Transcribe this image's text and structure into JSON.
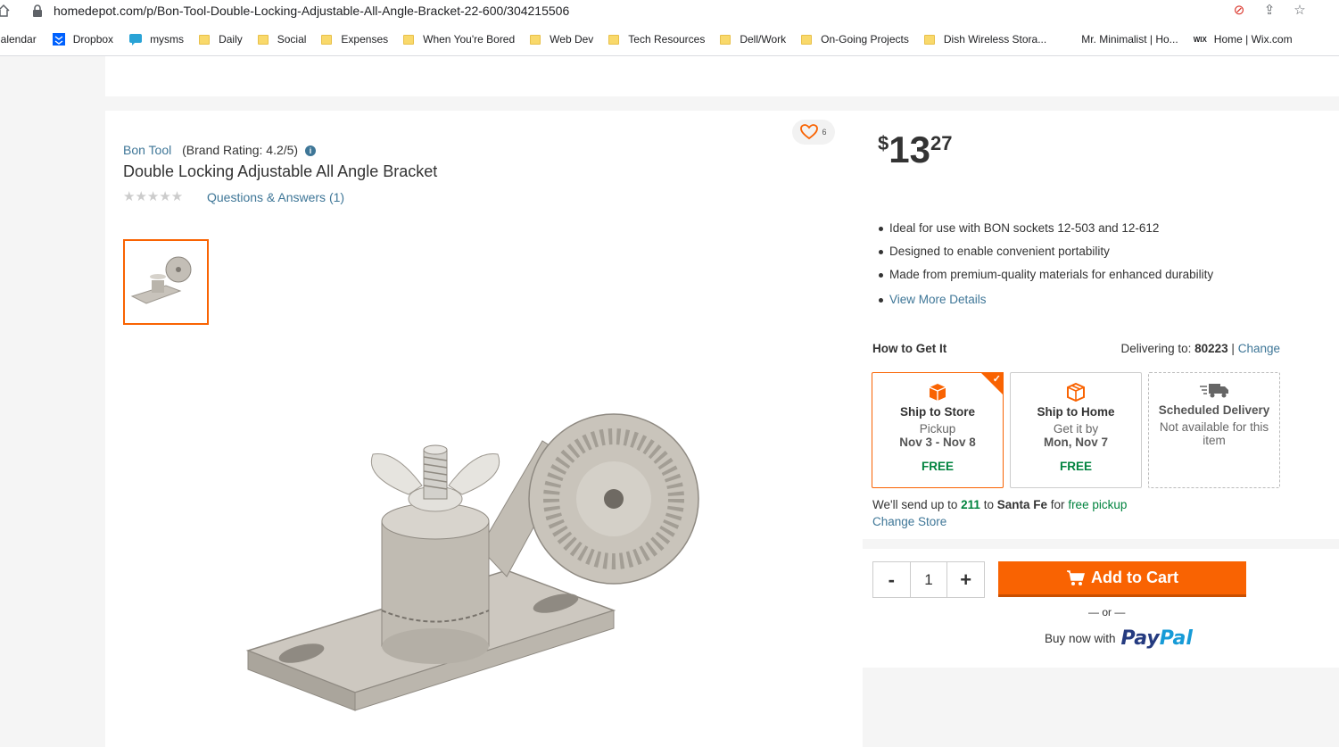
{
  "browser": {
    "url": "homedepot.com/p/Bon-Tool-Double-Locking-Adjustable-All-Angle-Bracket-22-600/304215506"
  },
  "bookmarks": [
    {
      "label": "Calendar",
      "icon": "calendar-icon"
    },
    {
      "label": "Dropbox",
      "icon": "dropbox-icon"
    },
    {
      "label": "mysms",
      "icon": "mysms-icon"
    },
    {
      "label": "Daily",
      "icon": "folder-icon"
    },
    {
      "label": "Social",
      "icon": "folder-icon"
    },
    {
      "label": "Expenses",
      "icon": "folder-icon"
    },
    {
      "label": "When You're Bored",
      "icon": "folder-icon"
    },
    {
      "label": "Web Dev",
      "icon": "folder-icon"
    },
    {
      "label": "Tech Resources",
      "icon": "folder-icon"
    },
    {
      "label": "Dell/Work",
      "icon": "folder-icon"
    },
    {
      "label": "On-Going Projects",
      "icon": "folder-icon"
    },
    {
      "label": "Dish Wireless Stora...",
      "icon": "folder-icon"
    },
    {
      "label": "Mr. Minimalist | Ho...",
      "icon": "page-icon"
    },
    {
      "label": "Home | Wix.com",
      "icon": "wix-icon"
    }
  ],
  "product": {
    "brand": "Bon Tool",
    "brand_rating": "(Brand Rating: 4.2/5)",
    "title": "Double Locking Adjustable All Angle Bracket",
    "stars": "★★★★★",
    "qa_link": "Questions & Answers (1)",
    "favorite_count": "6"
  },
  "price": {
    "currency": "$",
    "dollars": "13",
    "cents": "27"
  },
  "highlights": [
    "Ideal for use with BON sockets 12-503 and 12-612",
    "Designed to enable convenient portability",
    "Made from premium-quality materials for enhanced durability"
  ],
  "view_more": "View More Details",
  "fulfillment": {
    "heading": "How to Get It",
    "delivering_label": "Delivering to:",
    "zip": "80223",
    "separator": "|",
    "change": "Change",
    "options": [
      {
        "title": "Ship to Store",
        "line1": "Pickup",
        "line2": "Nov 3 - Nov 8",
        "price": "FREE"
      },
      {
        "title": "Ship to Home",
        "line1": "Get it by",
        "line2": "Mon, Nov 7",
        "price": "FREE"
      },
      {
        "title": "Scheduled Delivery",
        "line1": "Not available for this item"
      }
    ],
    "send_pre": "We'll send up to",
    "send_count": "211",
    "send_mid": "to",
    "store": "Santa Fe",
    "send_for": "for",
    "free_pickup": "free pickup",
    "change_store": "Change Store"
  },
  "cart": {
    "minus": "-",
    "qty": "1",
    "plus": "+",
    "add_to_cart": "Add to Cart",
    "or": "— or —",
    "buy_now": "Buy now with",
    "paypal_1": "Pay",
    "paypal_2": "Pal"
  },
  "colors": {
    "accent": "#f96302",
    "link": "#3e7697",
    "green": "#00833e"
  }
}
